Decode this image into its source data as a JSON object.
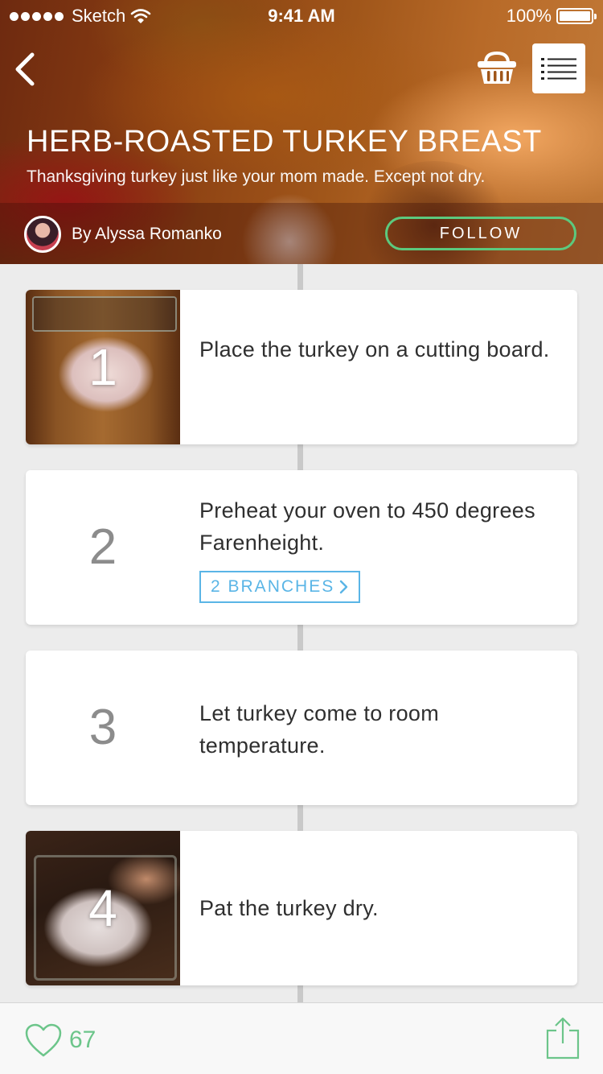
{
  "status_bar": {
    "carrier": "Sketch",
    "time": "9:41 AM",
    "battery": "100%"
  },
  "header": {
    "title": "HERB-ROASTED TURKEY BREAST",
    "subtitle": "Thanksgiving turkey just like your mom made. Except not dry.",
    "author": "By Alyssa Romanko",
    "follow_label": "FOLLOW"
  },
  "colors": {
    "accent_green": "#5cc97e",
    "branch_blue": "#5ab5e6"
  },
  "icons": {
    "back": "chevron-left-icon",
    "basket": "basket-icon",
    "list": "list-icon",
    "heart": "heart-icon",
    "share": "share-icon"
  },
  "steps": [
    {
      "number": "1",
      "text": "Place the turkey on a cutting board."
    },
    {
      "number": "2",
      "text": "Preheat your oven to 450 degrees Farenheight.",
      "branches_label": "2 BRANCHES"
    },
    {
      "number": "3",
      "text": "Let turkey come to room temperature."
    },
    {
      "number": "4",
      "text": "Pat the turkey dry."
    }
  ],
  "bottom_bar": {
    "likes": "67"
  }
}
